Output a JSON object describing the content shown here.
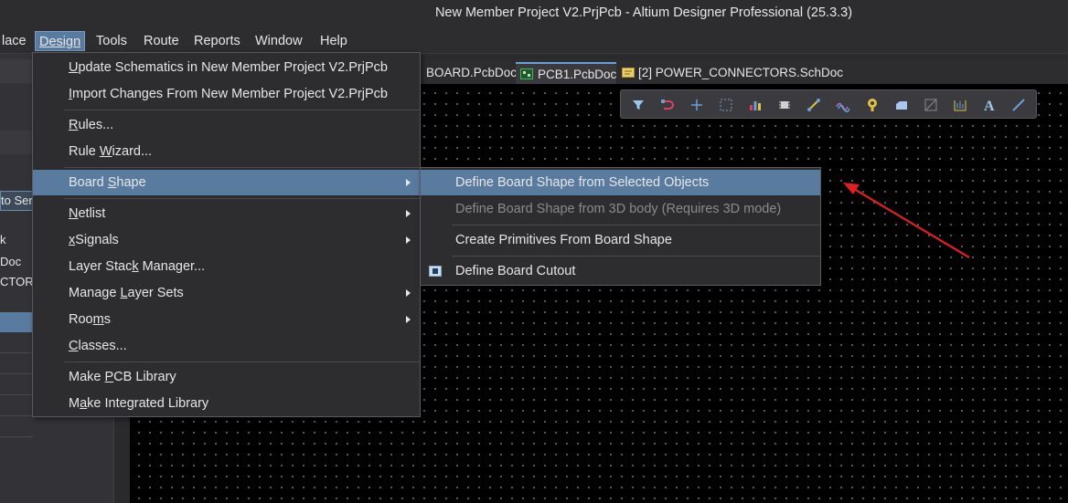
{
  "window": {
    "title": "New Member Project V2.PrjPcb - Altium Designer Professional (25.3.3)"
  },
  "menubar": [
    {
      "label": "lace"
    },
    {
      "label": "Design"
    },
    {
      "label": "Tools"
    },
    {
      "label": "Route"
    },
    {
      "label": "Reports"
    },
    {
      "label": "Window"
    },
    {
      "label": "Help"
    }
  ],
  "left_panel": {
    "rows": [
      "to Ser",
      "k",
      "Doc",
      "CTORS"
    ]
  },
  "tabs": [
    {
      "label": "BOARD.PcbDoc"
    },
    {
      "label": "PCB1.PcbDoc"
    },
    {
      "label": "[2] POWER_CONNECTORS.SchDoc"
    }
  ],
  "toolbar_icons": [
    "filter-icon",
    "interactive-routing-icon",
    "crosshair-icon",
    "select-rectangle-icon",
    "bar-chart-icon",
    "component-icon",
    "route-icon",
    "diff-pair-icon",
    "pad-icon",
    "polygon-fill-icon",
    "keepout-icon",
    "dimension-icon",
    "text-icon",
    "line-icon"
  ],
  "design_menu": {
    "items": [
      {
        "label": "Update Schematics in New Member Project V2.PrjPcb",
        "u": "U"
      },
      {
        "label": "Import Changes From New Member Project V2.PrjPcb",
        "u": "I"
      },
      {
        "label": "Rules...",
        "u": "R"
      },
      {
        "label": "Rule Wizard...",
        "u": "W"
      },
      {
        "label": "Board Shape",
        "u": "S"
      },
      {
        "label": "Netlist",
        "u": "N"
      },
      {
        "label": "xSignals",
        "u": "x"
      },
      {
        "label": "Layer Stack Manager...",
        "u": "k"
      },
      {
        "label": "Manage Layer Sets",
        "u": "L"
      },
      {
        "label": "Rooms",
        "u": "m"
      },
      {
        "label": "Classes...",
        "u": "C"
      },
      {
        "label": "Make PCB Library",
        "u": "P"
      },
      {
        "label": "Make Integrated Library",
        "u": "a"
      }
    ]
  },
  "board_shape_submenu": {
    "items": [
      {
        "label": "Define Board Shape from Selected Objects"
      },
      {
        "label": "Define Board Shape from 3D body (Requires 3D mode)"
      },
      {
        "label": "Create Primitives From Board Shape"
      },
      {
        "label": "Define Board Cutout"
      }
    ]
  },
  "annotation": {
    "arrow_color": "#e02020"
  }
}
